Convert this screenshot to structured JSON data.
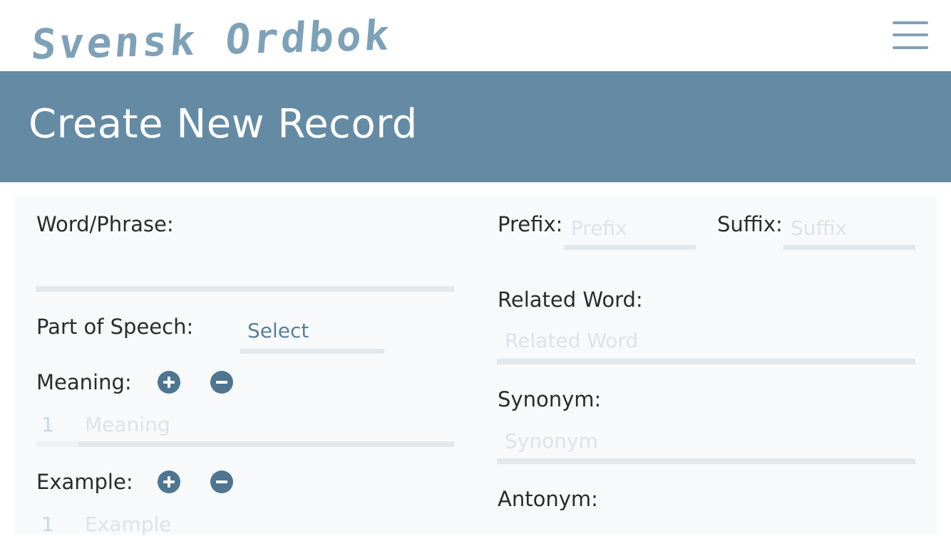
{
  "app": {
    "logo_text": "Svensk Ordbok"
  },
  "page": {
    "title": "Create New Record"
  },
  "form": {
    "word": {
      "label": "Word/Phrase:",
      "value": ""
    },
    "part_of_speech": {
      "label": "Part of Speech:",
      "selected": "Select"
    },
    "meaning": {
      "label": "Meaning:",
      "index": "1",
      "placeholder": "Meaning"
    },
    "example": {
      "label": "Example:",
      "index": "1",
      "placeholder": "Example"
    },
    "prefix": {
      "label": "Prefix:",
      "placeholder": "Prefix"
    },
    "suffix": {
      "label": "Suffix:",
      "placeholder": "Suffix"
    },
    "related": {
      "label": "Related Word:",
      "placeholder": "Related Word"
    },
    "synonym": {
      "label": "Synonym:",
      "placeholder": "Synonym"
    },
    "antonym": {
      "label": "Antonym:"
    }
  },
  "icons": {
    "menu": "hamburger-menu-icon",
    "add": "plus-circle-icon",
    "remove": "minus-circle-icon"
  },
  "colors": {
    "brand": "#658aa4",
    "logo": "#7fa1b7",
    "button": "#4f7591",
    "card_bg": "#f7f9fb",
    "input_line": "#e3e8ec"
  }
}
